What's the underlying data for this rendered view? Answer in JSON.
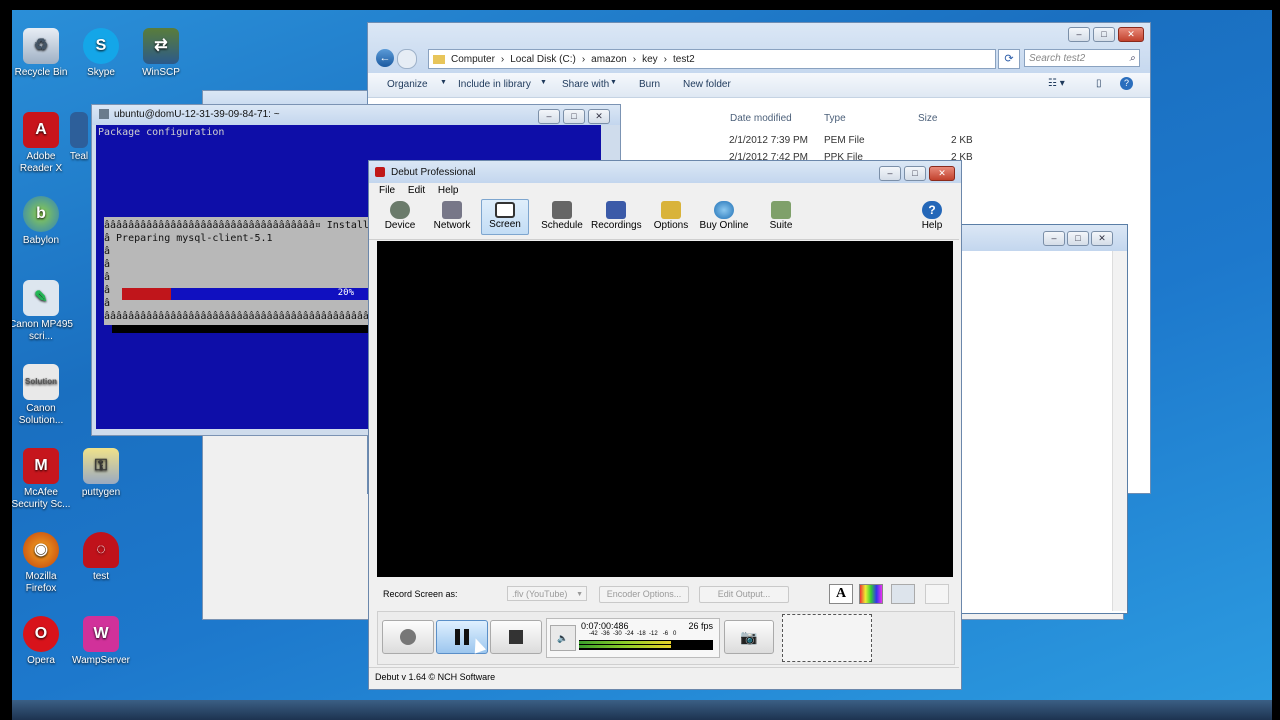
{
  "desktop_icons": [
    {
      "label": "Recycle Bin",
      "icon": "recycle-bin-icon"
    },
    {
      "label": "Skype",
      "icon": "skype-icon"
    },
    {
      "label": "WinSCP",
      "icon": "winscp-icon"
    },
    {
      "label": "Adobe Reader X",
      "icon": "adobe-reader-icon"
    },
    {
      "label": "Teal",
      "icon": "app-icon"
    },
    {
      "label": "Babylon",
      "icon": "babylon-icon"
    },
    {
      "label": "Canon MP495 scri...",
      "icon": "canon-icon"
    },
    {
      "label": "Canon Solution...",
      "icon": "canon-solution-icon"
    },
    {
      "label": "McAfee Security Sc...",
      "icon": "mcafee-icon"
    },
    {
      "label": "puttygen",
      "icon": "puttygen-icon"
    },
    {
      "label": "Mozilla Firefox",
      "icon": "firefox-icon"
    },
    {
      "label": "test",
      "icon": "test-icon"
    },
    {
      "label": "Opera",
      "icon": "opera-icon"
    },
    {
      "label": "WampServer",
      "icon": "wampserver-icon"
    }
  ],
  "explorer": {
    "breadcrumb": [
      "Computer",
      "Local Disk (C:)",
      "amazon",
      "key",
      "test2"
    ],
    "search_placeholder": "Search test2",
    "toolbar": {
      "organize": "Organize",
      "include": "Include in library",
      "share": "Share with",
      "burn": "Burn",
      "new_folder": "New folder"
    },
    "columns": {
      "date": "Date modified",
      "type": "Type",
      "size": "Size"
    },
    "files": [
      {
        "date": "2/1/2012 7:39 PM",
        "type": "PEM File",
        "size": "2 KB"
      },
      {
        "date": "2/1/2012 7:42 PM",
        "type": "PPK File",
        "size": "2 KB"
      }
    ]
  },
  "putty": {
    "title": "ubuntu@domU-12-31-39-09-84-71: ~",
    "heading": "Package configuration",
    "line_top": "âââââââââââââââââââââââââââââââââââ¤ Installing p",
    "preparing": "â Preparing mysql-client-5.1",
    "line_bottom": "âââââââââââââââââââââââââââââââââââââââââââââââââ",
    "progress_percent": 20,
    "progress_label": "20%"
  },
  "debut": {
    "title": "Debut Professional",
    "menu": {
      "file": "File",
      "edit": "Edit",
      "help": "Help"
    },
    "toolbar": {
      "device": "Device",
      "network": "Network",
      "screen": "Screen",
      "schedule": "Schedule",
      "recordings": "Recordings",
      "options": "Options",
      "buy_online": "Buy Online",
      "suite": "Suite",
      "help": "Help"
    },
    "record_as_label": "Record Screen as:",
    "format_value": ".flv (YouTube)",
    "encoder_options": "Encoder Options...",
    "edit_output": "Edit Output...",
    "time": "0:07:00:486",
    "fps": "26 fps",
    "meter_scale": "-42  -36  -30  -24  -18  -12   -6   0",
    "status": "Debut v 1.64 © NCH Software"
  }
}
